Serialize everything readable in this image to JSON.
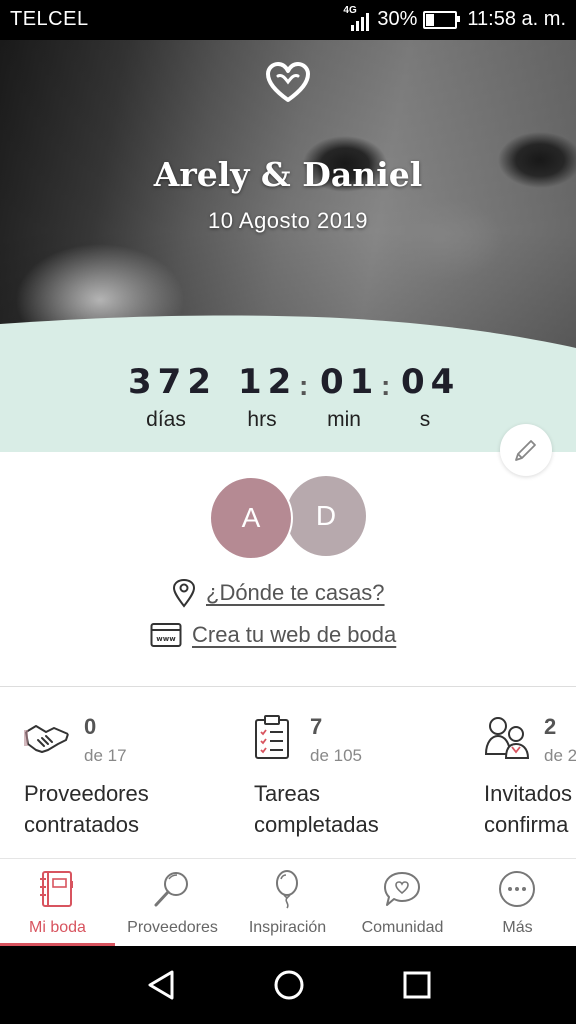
{
  "status_bar": {
    "carrier": "TELCEL",
    "network": "4G",
    "battery_text": "30%",
    "battery_level": 0.3,
    "time": "11:58 a. m."
  },
  "hero": {
    "couple_names": "Arely & Daniel",
    "wedding_date": "10 Agosto 2019"
  },
  "countdown": {
    "days": "372",
    "hours": "12",
    "minutes": "01",
    "seconds": "04",
    "days_label": "días",
    "hours_label": "hrs",
    "minutes_label": "min",
    "seconds_label": "s",
    "separator": ":"
  },
  "avatars": {
    "partner1_initial": "A",
    "partner2_initial": "D"
  },
  "links": {
    "where_label": "¿Dónde te casas?",
    "web_label": "Crea tu web de boda"
  },
  "stats": [
    {
      "icon": "handshake-icon",
      "value": "0",
      "total": "de 17",
      "label_line1": "Proveedores",
      "label_line2": "contratados"
    },
    {
      "icon": "checklist-icon",
      "value": "7",
      "total": "de 105",
      "label_line1": "Tareas",
      "label_line2": "completadas"
    },
    {
      "icon": "guests-icon",
      "value": "2",
      "total": "de 2",
      "label_line1": "Invitados",
      "label_line2": "confirma"
    }
  ],
  "bottom_nav": [
    {
      "label": "Mi boda",
      "icon": "notebook-icon",
      "active": true
    },
    {
      "label": "Proveedores",
      "icon": "magnifier-icon",
      "active": false
    },
    {
      "label": "Inspiración",
      "icon": "balloon-icon",
      "active": false
    },
    {
      "label": "Comunidad",
      "icon": "chat-heart-icon",
      "active": false
    },
    {
      "label": "Más",
      "icon": "more-icon",
      "active": false
    }
  ],
  "colors": {
    "accent": "#d8545f",
    "mint": "#d9ede6",
    "avatar_a": "#b58a93",
    "avatar_d": "#b7a9ad"
  }
}
